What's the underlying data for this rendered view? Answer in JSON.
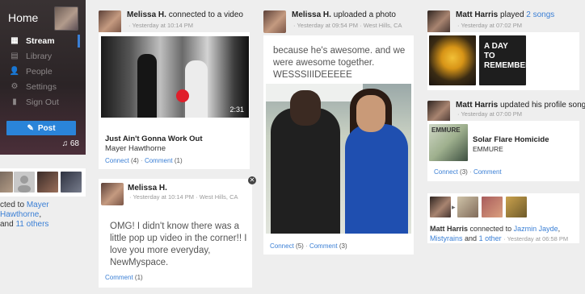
{
  "sidebar": {
    "title": "Home",
    "nav": [
      {
        "label": "Stream",
        "icon": "stream-icon",
        "glyph": "▦"
      },
      {
        "label": "Library",
        "icon": "library-icon",
        "glyph": "▤"
      },
      {
        "label": "People",
        "icon": "people-icon",
        "glyph": "👤"
      },
      {
        "label": "Settings",
        "icon": "gear-icon",
        "glyph": "⚙"
      },
      {
        "label": "Sign Out",
        "icon": "signout-icon",
        "glyph": "▮"
      }
    ],
    "post_label": "Post",
    "music_count": "68"
  },
  "left_partial": {
    "line1_prefix": "cted to",
    "line1_link": "Mayer Hawthorne",
    "line1_suffix": ",",
    "line2_prefix": "and",
    "line2_link": "11 others"
  },
  "col1": {
    "card1": {
      "name": "Melissa H.",
      "action": "connected to a video",
      "time": "Yesterday at 10:14 PM",
      "video_duration": "2:31",
      "title": "Just Ain't Gonna Work Out",
      "artist": "Mayer Hawthorne",
      "connect": "Connect",
      "connect_count": "(4)",
      "comment": "Comment",
      "comment_count": "(1)"
    },
    "card2": {
      "name": "Melissa H.",
      "time": "Yesterday at 10:14 PM",
      "location": "West Hills, CA",
      "text": "OMG! I didn't know there was a little pop up video in the corner!! I love you more everyday, NewMyspace.",
      "comment": "Comment",
      "comment_count": "(1)"
    }
  },
  "col2": {
    "name": "Melissa H.",
    "action": "uploaded a photo",
    "time": "Yesterday at 09:54 PM",
    "location": "West Hills, CA",
    "text": "because he's awesome. and we were awesome together. WESSSIIIDEEEEE",
    "connect": "Connect",
    "connect_count": "(5)",
    "comment": "Comment",
    "comment_count": "(3)"
  },
  "col3": {
    "card1": {
      "name": "Matt Harris",
      "action": "played",
      "link": "2 songs",
      "time": "Yesterday at 07:02 PM",
      "album2_text": "A DAY TO REMEMBER"
    },
    "card2": {
      "name": "Matt Harris",
      "action": "updated his profile song",
      "time": "Yesterday at 07:00 PM",
      "song": "Solar Flare Homicide",
      "artist": "EMMURE",
      "album_text": "EMMURE",
      "connect": "Connect",
      "connect_count": "(3)",
      "comment": "Comment"
    },
    "card3": {
      "name": "Matt Harris",
      "action": "connected to",
      "link1": "Jazmin Jayde",
      "link2": "Mistyrains",
      "and": "and",
      "link3": "1 other",
      "time": "Yesterday at 06:58 PM"
    }
  },
  "colors": {
    "accent": "#2a84d9",
    "link": "#3a7fd5",
    "sidebar_bg": "#2b2526",
    "page_bg": "#eeeeee"
  }
}
